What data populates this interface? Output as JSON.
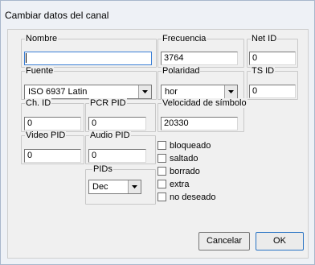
{
  "window": {
    "title": "Cambiar datos del canal"
  },
  "fields": {
    "nombre": {
      "label": "Nombre",
      "value": ""
    },
    "frecuencia": {
      "label": "Frecuencia",
      "value": "3764"
    },
    "net_id": {
      "label": "Net ID",
      "value": "0"
    },
    "fuente": {
      "label": "Fuente",
      "value": "ISO 6937 Latin"
    },
    "polaridad": {
      "label": "Polaridad",
      "value": "hor"
    },
    "ts_id": {
      "label": "TS ID",
      "value": "0"
    },
    "ch_id": {
      "label": "Ch. ID",
      "value": "0"
    },
    "pcr_pid": {
      "label": "PCR PID",
      "value": "0"
    },
    "velocidad": {
      "label": "Velocidad de símbolo",
      "value": "20330"
    },
    "video_pid": {
      "label": "Video PID",
      "value": "0"
    },
    "audio_pid": {
      "label": "Audio PID",
      "value": "0"
    },
    "pids": {
      "label": "PIDs",
      "value": "Dec"
    }
  },
  "checkboxes": [
    {
      "label": "bloqueado",
      "checked": false
    },
    {
      "label": "saltado",
      "checked": false
    },
    {
      "label": "borrado",
      "checked": false
    },
    {
      "label": "extra",
      "checked": false
    },
    {
      "label": "no deseado",
      "checked": false
    }
  ],
  "buttons": {
    "cancel": "Cancelar",
    "ok": "OK"
  }
}
